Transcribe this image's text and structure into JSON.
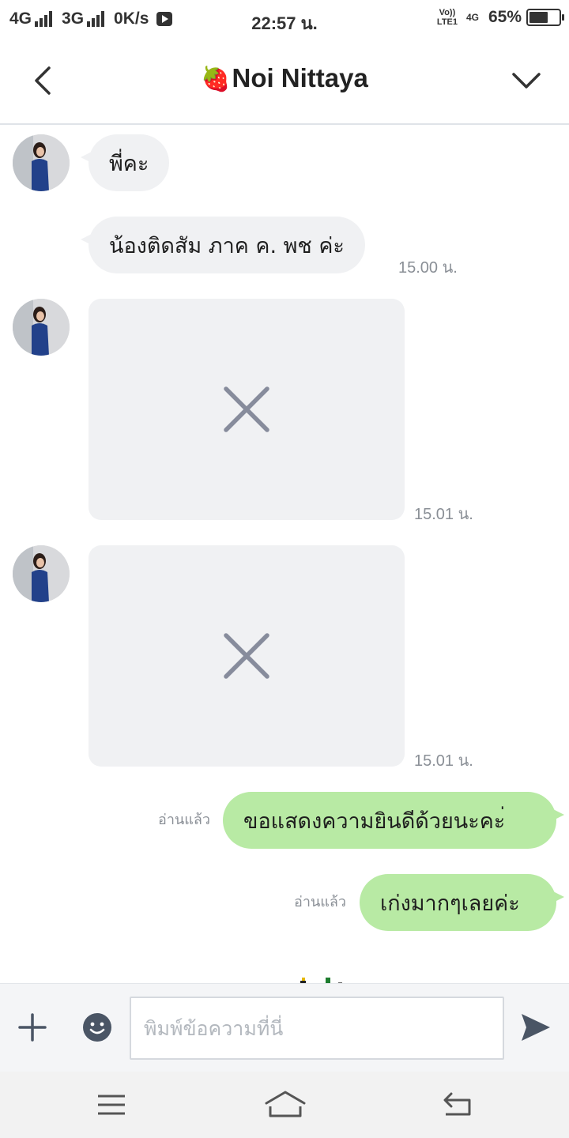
{
  "status_bar": {
    "network1": "4G",
    "network2": "3G",
    "speed": "0K/s",
    "time": "22:57 น.",
    "volte_top": "Vo))",
    "volte_bottom": "LTE1",
    "net_small": "4G",
    "battery_percent": "65%",
    "battery_level": 0.65
  },
  "header": {
    "title_emoji": "🍓",
    "title": "Noi Nittaya"
  },
  "messages": [
    {
      "type": "text",
      "direction": "incoming",
      "text": "พี่คะ"
    },
    {
      "type": "text",
      "direction": "incoming",
      "text": "น้องติดสัม ภาค ค. พช ค่ะ",
      "time": "15.00 น."
    },
    {
      "type": "image_failed",
      "direction": "incoming",
      "time": "15.01 น."
    },
    {
      "type": "image_failed",
      "direction": "incoming",
      "time": "15.01 น."
    },
    {
      "type": "text",
      "direction": "outgoing",
      "text": "ขอแสดงความยินดีด้วยนะคะ่",
      "read_label": "อ่านแล้ว"
    },
    {
      "type": "text",
      "direction": "outgoing",
      "text": "เก่งมากๆเลยค่ะ",
      "read_label": "อ่านแล้ว"
    }
  ],
  "input_bar": {
    "placeholder": "พิมพ์ข้อความที่นี่",
    "value": ""
  },
  "colors": {
    "incoming_bubble": "#f0f1f3",
    "outgoing_bubble": "#b8eaa4",
    "meta_text": "#8a8f96",
    "icon": "#4a5565"
  },
  "icons": {
    "back": "chevron-left-icon",
    "menu": "chevron-down-icon",
    "failed_image": "close-icon",
    "plus": "plus-icon",
    "emoji": "smiley-icon",
    "send": "send-icon",
    "nav_menu": "hamburger-icon",
    "nav_home": "home-icon",
    "nav_back": "back-icon"
  }
}
